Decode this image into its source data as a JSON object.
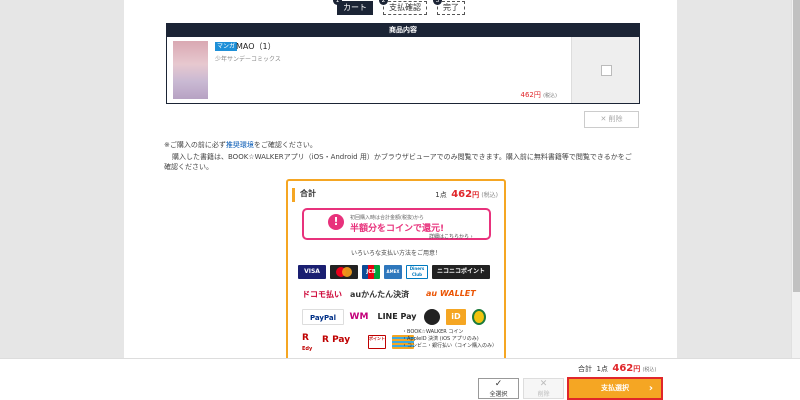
{
  "steps": [
    {
      "num": "1",
      "label": "カート",
      "active": true
    },
    {
      "num": "2",
      "label": "支払確認",
      "active": false
    },
    {
      "num": "3",
      "label": "完了",
      "active": false
    }
  ],
  "product": {
    "header": "商品内容",
    "tag": "マンガ",
    "title": "MAO（1）",
    "publisher": "少年サンデーコミックス",
    "price": "462",
    "price_unit": "円",
    "tax": "(税込)"
  },
  "delete_label": "削除",
  "notes": {
    "prefix": "※ご購入の前に必ず",
    "link": "推奨環境",
    "suffix": "をご確認ください。",
    "line2": "購入した書籍は、BOOK☆WALKERアプリ（iOS・Android 用）かブラウザビューアでのみ閲覧できます。購入前に無料書籍等で閲覧できるかをご確認ください。"
  },
  "summary": {
    "label": "合計",
    "count": "1点",
    "price": "462",
    "unit": "円",
    "tax": "(税込)",
    "promo_line1": "初回購入時は合計金額(税抜)から",
    "promo_line2": "半額分をコインで還元!",
    "promo_link": "詳細はこちらから",
    "pay_intro": "いろいろな支払い方法をご用意！"
  },
  "payments": {
    "visa": "VISA",
    "jcb": "JCB",
    "amex": "AMEX",
    "diners": "Diners Club",
    "niconico": "ニコニコポイント",
    "docomo": "ドコモ払い",
    "au": "auかんたん決済",
    "au_wallet": "au WALLET",
    "paypal": "PayPal",
    "webmoney": "WM",
    "linepay": "LINE Pay",
    "rakuten_pay": "R Pay",
    "edy": "Edy",
    "id": "iD",
    "list": [
      "・BOOK☆WALKER コイン",
      "・AppleID 決済 (iOS アプリのみ)",
      "・コンビニ・銀行払い（コイン購入のみ）"
    ]
  },
  "footer": {
    "total_label": "合計",
    "count": "1点",
    "price": "462",
    "unit": "円",
    "tax": "(税込)",
    "select_all": "全選択",
    "delete": "削除",
    "pay_button": "支払選択"
  },
  "colors": {
    "navy": "#1b2435",
    "orange": "#f5a623",
    "red": "#e0262a",
    "pink": "#e8327c"
  }
}
